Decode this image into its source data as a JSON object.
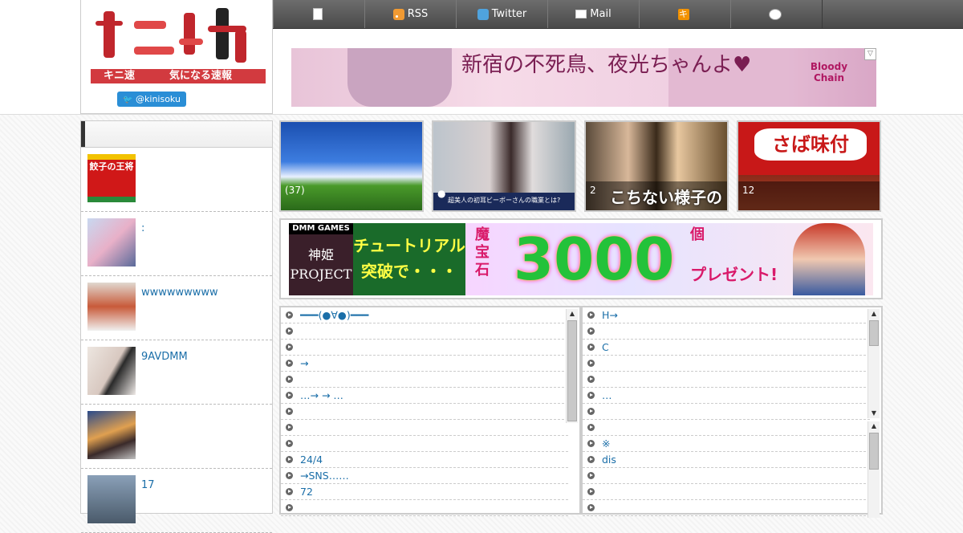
{
  "site": {
    "logo_text": "キニ速",
    "tagline": "気になる速報",
    "twitter_follow": "@kinisoku"
  },
  "nav": [
    {
      "label": "",
      "icon": "document-icon"
    },
    {
      "label": "RSS",
      "icon": "rss-icon"
    },
    {
      "label": "Twitter",
      "icon": "twitter-icon"
    },
    {
      "label": "Mail",
      "icon": "mail-icon"
    },
    {
      "label": "",
      "icon": "kinisoku-icon"
    },
    {
      "label": "",
      "icon": "face-icon"
    }
  ],
  "top_banner": {
    "text": "新宿の不死鳥、夜光ちゃんよ♥",
    "logo": "Bloody Chain"
  },
  "sidebar": {
    "items": [
      {
        "title": "",
        "thumb_text": "餃子の王将"
      },
      {
        "title": ":",
        "thumb_text": ""
      },
      {
        "title": "wwwwwwwww",
        "thumb_text": ""
      },
      {
        "title": "9AVDMM",
        "thumb_text": ""
      },
      {
        "title": "",
        "thumb_text": ""
      },
      {
        "title": "17",
        "thumb_text": ""
      }
    ]
  },
  "features": [
    {
      "count": "(37)",
      "overlay": ""
    },
    {
      "count": "",
      "overlay": "超美人の初耳ビーボーさんの職業とは?"
    },
    {
      "count": "2",
      "overlay": "こちない様子の"
    },
    {
      "count": "12",
      "overlay": "さば味付"
    }
  ],
  "mid_banner": {
    "brand": "DMM GAMES",
    "project": "神姫 PROJECT",
    "left_text": "チュートリアル突破で・・・",
    "item": "魔宝石",
    "number": "3000",
    "unit": "個",
    "present": "プレゼント!"
  },
  "left_links": [
    "━━━(●∀●)━━━",
    "",
    "",
    "→",
    "",
    "…→ → …",
    "",
    "",
    "",
    "24/4",
    "→SNS……",
    "72",
    ""
  ],
  "right_links": [
    "H→",
    "",
    "C",
    "",
    "",
    "…",
    "",
    "",
    "※",
    "dis",
    "",
    "",
    ""
  ]
}
